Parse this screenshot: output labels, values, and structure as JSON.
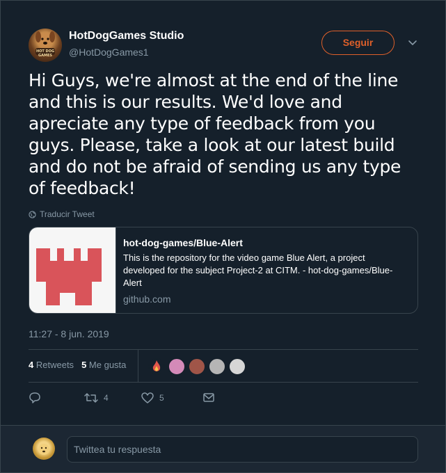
{
  "author": {
    "name": "HotDogGames Studio",
    "handle": "@HotDogGames1",
    "avatar_caption": "HOT DOG GAMES"
  },
  "follow_button": {
    "label": "Seguir",
    "color": "#e0602a"
  },
  "tweet": {
    "text": "Hi Guys, we're almost at the end of the line and this  is our results. We'd love and apreciate any type of feedback from you guys. Please, take a look at our latest build and do not be afraid of sending us any type of feedback!",
    "translate_label": "Traducir Tweet",
    "timestamp": "11:27 - 8 jun. 2019"
  },
  "link_card": {
    "title": "hot-dog-games/Blue-Alert",
    "description": "This is the repository for the video game Blue Alert, a project developed for the subject Project-2 at CITM. - hot-dog-games/Blue-Alert",
    "domain": "github.com",
    "thumb_color": "#d9545a"
  },
  "stats": {
    "retweets_count": "4",
    "retweets_label": "Retweets",
    "likes_count": "5",
    "likes_label": "Me gusta"
  },
  "likers": [
    {
      "name": "fire-avatar",
      "color": "#e2574c"
    },
    {
      "name": "pink-avatar",
      "color": "#d48ab8"
    },
    {
      "name": "red-hair-avatar",
      "color": "#a05548"
    },
    {
      "name": "glasses-avatar",
      "color": "#b5b5b5"
    },
    {
      "name": "anime-avatar",
      "color": "#d6d6d6"
    }
  ],
  "actions": {
    "reply_count": "",
    "retweet_count": "4",
    "like_count": "5"
  },
  "reply": {
    "placeholder": "Twittea tu respuesta"
  },
  "colors": {
    "background": "#15202b",
    "border": "#38444d",
    "secondary_text": "#8899a6"
  }
}
